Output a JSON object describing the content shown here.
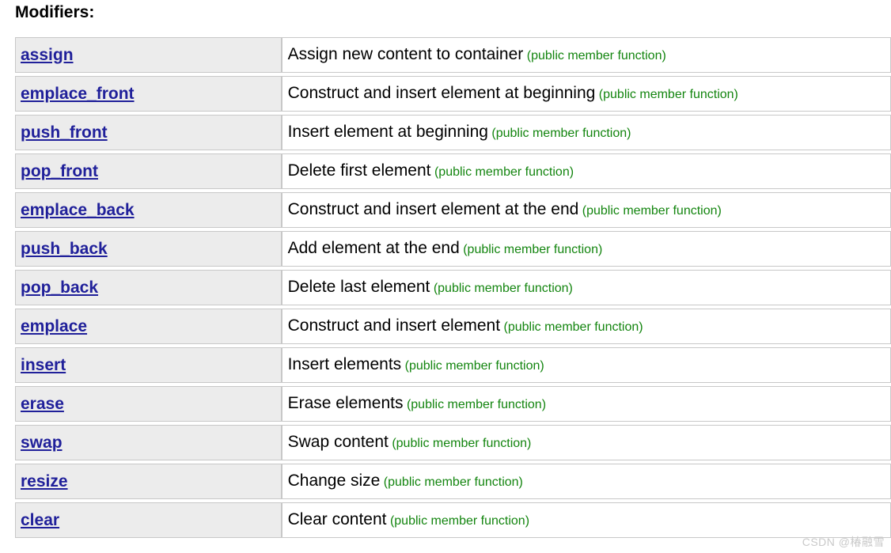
{
  "heading": "Modifiers:",
  "table": {
    "rows": [
      {
        "name": "assign",
        "desc": "Assign new content to container",
        "kind": "(public member function)"
      },
      {
        "name": "emplace_front",
        "desc": "Construct and insert element at beginning",
        "kind": "(public member function)"
      },
      {
        "name": "push_front",
        "desc": "Insert element at beginning",
        "kind": "(public member function)"
      },
      {
        "name": "pop_front",
        "desc": "Delete first element",
        "kind": "(public member function)"
      },
      {
        "name": "emplace_back",
        "desc": "Construct and insert element at the end",
        "kind": "(public member function)"
      },
      {
        "name": "push_back",
        "desc": "Add element at the end",
        "kind": "(public member function)"
      },
      {
        "name": "pop_back",
        "desc": "Delete last element",
        "kind": "(public member function)"
      },
      {
        "name": "emplace",
        "desc": "Construct and insert element",
        "kind": "(public member function)"
      },
      {
        "name": "insert",
        "desc": "Insert elements",
        "kind": "(public member function)"
      },
      {
        "name": "erase",
        "desc": "Erase elements",
        "kind": "(public member function)"
      },
      {
        "name": "swap",
        "desc": "Swap content",
        "kind": "(public member function)"
      },
      {
        "name": "resize",
        "desc": "Change size",
        "kind": "(public member function)"
      },
      {
        "name": "clear",
        "desc": "Clear content",
        "kind": "(public member function)"
      }
    ]
  },
  "watermark": "CSDN @椿融雪",
  "colors": {
    "link": "#20209a",
    "kind": "#13850f",
    "name_cell_bg": "#ececec",
    "border": "#c8c8c8",
    "watermark": "#c9c9c9"
  }
}
